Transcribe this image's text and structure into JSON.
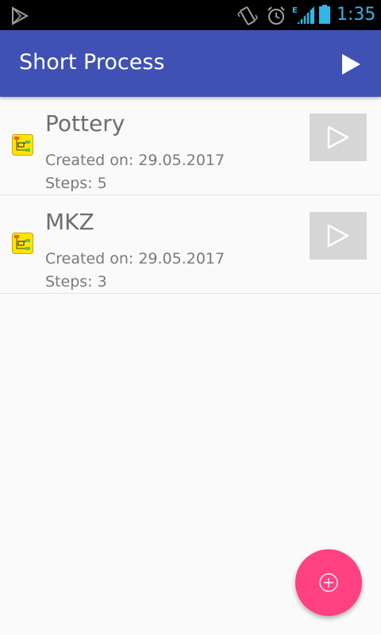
{
  "status_bar": {
    "time": "1:35",
    "network_type": "E",
    "icons": [
      "play-store-icon",
      "vibrate-icon",
      "alarm-icon",
      "signal-icon",
      "battery-icon"
    ]
  },
  "app_bar": {
    "title": "Short Process",
    "action_icon": "play-icon",
    "background_color": "#3f51b5"
  },
  "processes": [
    {
      "name": "Pottery",
      "created_label": "Created on:",
      "created_date": "29.05.2017",
      "steps_label": "Steps:",
      "steps": "5",
      "icon": "process-flow-icon",
      "action_icon": "play-icon"
    },
    {
      "name": "MKZ",
      "created_label": "Created on:",
      "created_date": "29.05.2017",
      "steps_label": "Steps:",
      "steps": "3",
      "icon": "process-flow-icon",
      "action_icon": "play-icon"
    }
  ],
  "fab": {
    "icon": "add-circle-icon",
    "color": "#ff4081"
  },
  "colors": {
    "accent": "#ff4081",
    "primary": "#3f51b5",
    "status_blue": "#33b5e5",
    "background": "#fafafa"
  }
}
